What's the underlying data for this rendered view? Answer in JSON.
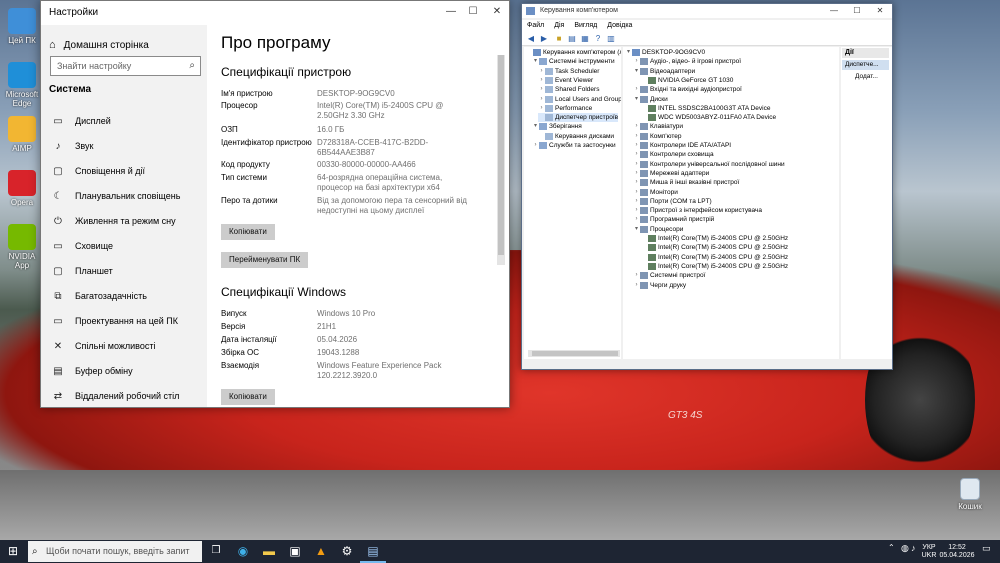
{
  "desktop": {
    "icons": [
      {
        "label": "Цей ПК"
      },
      {
        "label": "Microsoft Edge"
      },
      {
        "label": "AIMP"
      },
      {
        "label": "Opera"
      },
      {
        "label": "NVIDIA App"
      }
    ],
    "recycle_bin": "Кошик",
    "plate": "GT3 4S"
  },
  "settings": {
    "window_title": "Настройки",
    "home": "Домашня сторінка",
    "search_placeholder": "Знайти настройку",
    "category": "Система",
    "nav": [
      "Дисплей",
      "Звук",
      "Сповіщення й дії",
      "Планувальник сповіщень",
      "Живлення та режим сну",
      "Сховище",
      "Планшет",
      "Багатозадачність",
      "Проектування на цей ПК",
      "Спільні можливості",
      "Буфер обміну",
      "Віддалений робочий стіл"
    ],
    "page_title": "Про програму",
    "device_specs_title": "Специфікації пристрою",
    "device_specs": [
      {
        "k": "Ім'я пристрою",
        "v": "DESKTOP-9OG9CV0"
      },
      {
        "k": "Процесор",
        "v": "Intel(R) Core(TM) i5-2400S CPU @ 2.50GHz   3.30 GHz"
      },
      {
        "k": "ОЗП",
        "v": "16.0 ГБ"
      },
      {
        "k": "Ідентифікатор пристрою",
        "v": "D728318A-CCEB-417C-B2DD-6B544AAE3B87"
      },
      {
        "k": "Код продукту",
        "v": "00330-80000-00000-AA466"
      },
      {
        "k": "Тип системи",
        "v": "64-розрядна операційна система, процесор на базі архітектури x64"
      },
      {
        "k": "Перо та дотики",
        "v": "Від за допомогою пера та сенсорний від недоступні на цьому дисплеї"
      }
    ],
    "copy_button": "Копіювати",
    "rename_button": "Перейменувати ПК",
    "windows_specs_title": "Специфікації Windows",
    "windows_specs": [
      {
        "k": "Випуск",
        "v": "Windows 10 Pro"
      },
      {
        "k": "Версія",
        "v": "21H1"
      },
      {
        "k": "Дата інсталяції",
        "v": "05.04.2026"
      },
      {
        "k": "Збірка ОС",
        "v": "19043.1288"
      },
      {
        "k": "Взаємодія",
        "v": "Windows Feature Experience Pack 120.2212.3920.0"
      }
    ],
    "copy_button_2": "Копіювати"
  },
  "cm": {
    "window_title": "Керування комп'ютером",
    "menu": [
      "Файл",
      "Дія",
      "Вигляд",
      "Довідка"
    ],
    "left_tree": [
      {
        "label": "Керування комп'ютером (лок",
        "exp": "",
        "depth": 0
      },
      {
        "label": "Системні інструменти",
        "exp": "▾",
        "depth": 1
      },
      {
        "label": "Task Scheduler",
        "exp": "›",
        "depth": 2
      },
      {
        "label": "Event Viewer",
        "exp": "›",
        "depth": 2
      },
      {
        "label": "Shared Folders",
        "exp": "›",
        "depth": 2
      },
      {
        "label": "Local Users and Groups",
        "exp": "›",
        "depth": 2
      },
      {
        "label": "Performance",
        "exp": "›",
        "depth": 2
      },
      {
        "label": "Диспетчер пристроїв",
        "exp": "",
        "depth": 2,
        "sel": true
      },
      {
        "label": "Зберігання",
        "exp": "▾",
        "depth": 1
      },
      {
        "label": "Керування дисками",
        "exp": "",
        "depth": 2
      },
      {
        "label": "Служби та застосунки",
        "exp": "›",
        "depth": 1
      }
    ],
    "device_tree": [
      {
        "label": "DESKTOP-9OG9CV0",
        "exp": "▾",
        "depth": 0
      },
      {
        "label": "Аудіо-, відео- й ігрові пристрої",
        "exp": "›",
        "depth": 1
      },
      {
        "label": "Відеоадаптери",
        "exp": "▾",
        "depth": 1
      },
      {
        "label": "NVIDIA GeForce GT 1030",
        "exp": "",
        "depth": 2
      },
      {
        "label": "Вхідні та вихідні аудіопристрої",
        "exp": "›",
        "depth": 1
      },
      {
        "label": "Диски",
        "exp": "▾",
        "depth": 1
      },
      {
        "label": "INTEL SSDSC2BA100G3T ATA Device",
        "exp": "",
        "depth": 2
      },
      {
        "label": "WDC WD5003ABYZ-011FA0 ATA Device",
        "exp": "",
        "depth": 2
      },
      {
        "label": "Клавіатури",
        "exp": "›",
        "depth": 1
      },
      {
        "label": "Комп'ютер",
        "exp": "›",
        "depth": 1
      },
      {
        "label": "Контролери IDE ATA/ATAPI",
        "exp": "›",
        "depth": 1
      },
      {
        "label": "Контролери сховища",
        "exp": "›",
        "depth": 1
      },
      {
        "label": "Контролери універсальної послідовної шини",
        "exp": "›",
        "depth": 1
      },
      {
        "label": "Мережеві адаптери",
        "exp": "›",
        "depth": 1
      },
      {
        "label": "Миша й інші вказівні пристрої",
        "exp": "›",
        "depth": 1
      },
      {
        "label": "Монітори",
        "exp": "›",
        "depth": 1
      },
      {
        "label": "Порти (COM та LPT)",
        "exp": "›",
        "depth": 1
      },
      {
        "label": "Пристрої з інтерфейсом користувача",
        "exp": "›",
        "depth": 1
      },
      {
        "label": "Програмний пристрій",
        "exp": "›",
        "depth": 1
      },
      {
        "label": "Процесори",
        "exp": "▾",
        "depth": 1
      },
      {
        "label": "Intel(R) Core(TM) i5-2400S CPU @ 2.50GHz",
        "exp": "",
        "depth": 2
      },
      {
        "label": "Intel(R) Core(TM) i5-2400S CPU @ 2.50GHz",
        "exp": "",
        "depth": 2
      },
      {
        "label": "Intel(R) Core(TM) i5-2400S CPU @ 2.50GHz",
        "exp": "",
        "depth": 2
      },
      {
        "label": "Intel(R) Core(TM) i5-2400S CPU @ 2.50GHz",
        "exp": "",
        "depth": 2
      },
      {
        "label": "Системні пристрої",
        "exp": "›",
        "depth": 1
      },
      {
        "label": "Черги друку",
        "exp": "›",
        "depth": 1
      }
    ],
    "actions_header": "Дії",
    "actions_selected": "Диспетче...",
    "actions_more": "Додат..."
  },
  "taskbar": {
    "search_placeholder": "Щоби почати пошук, введіть запит тут",
    "lang_top": "УКР",
    "lang_bottom": "UKR",
    "time": "12:52",
    "date": "05.04.2026"
  },
  "colors": {
    "accent": "#0078d7",
    "taskbar": "#1e2533",
    "car": "#c8241c"
  }
}
